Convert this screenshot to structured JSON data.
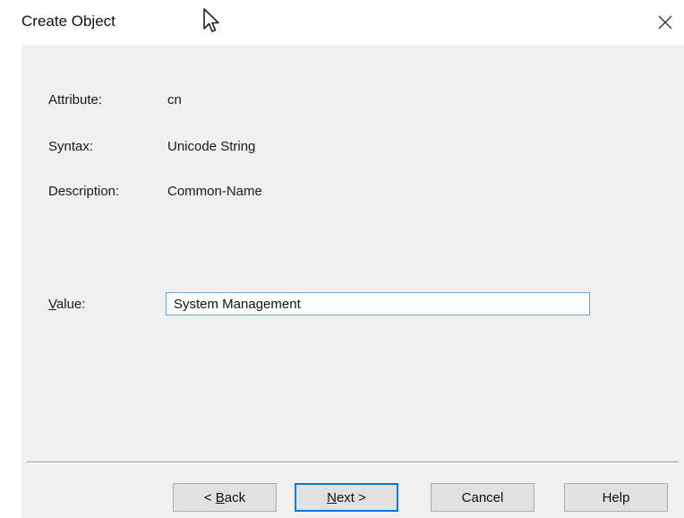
{
  "window": {
    "title": "Create Object",
    "close_glyph": "✕"
  },
  "attribute": {
    "label": "Attribute:",
    "value": "cn"
  },
  "syntax": {
    "label": "Syntax:",
    "value": "Unicode String"
  },
  "description": {
    "label": "Description:",
    "value": "Common-Name"
  },
  "value_field": {
    "label_prefix": "",
    "label_mnemonic": "V",
    "label_rest": "alue:",
    "current_value": "System Management"
  },
  "buttons": {
    "back": {
      "prefix": "< ",
      "mnemonic": "B",
      "rest": "ack"
    },
    "next": {
      "prefix": "",
      "mnemonic": "N",
      "rest": "ext >"
    },
    "cancel": "Cancel",
    "help": "Help"
  },
  "icons": {
    "close": "close-icon",
    "cursor": "mouse-pointer-icon"
  },
  "colors": {
    "dialog_background": "#f0f0f0",
    "input_border": "#6aa6d8",
    "default_button_border": "#0078d7"
  }
}
